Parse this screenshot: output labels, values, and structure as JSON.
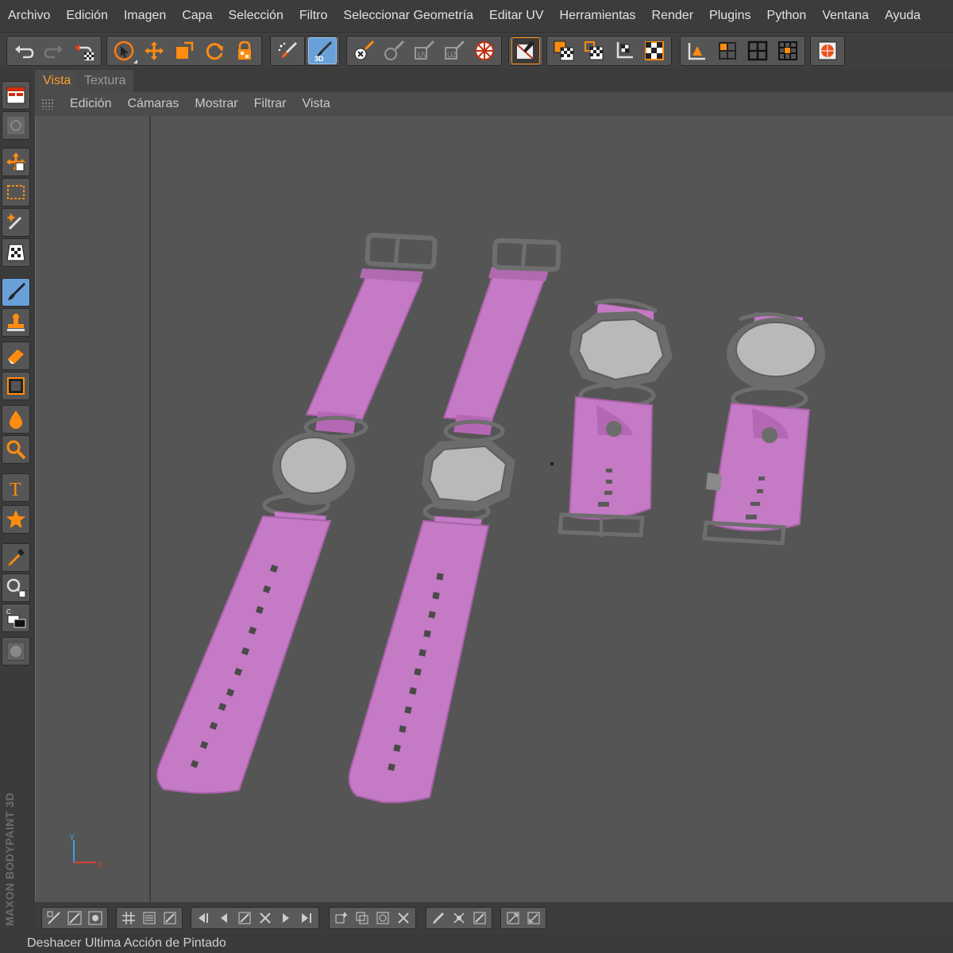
{
  "menubar": {
    "items": [
      "Archivo",
      "Edición",
      "Imagen",
      "Capa",
      "Selección",
      "Filtro",
      "Seleccionar Geometría",
      "Editar UV",
      "Herramientas",
      "Render",
      "Plugins",
      "Python",
      "Ventana",
      "Ayuda"
    ]
  },
  "toolbar": {
    "icons": [
      "undo-icon",
      "redo-icon",
      "undo-paint-icon",
      "live-selection-icon",
      "move-icon",
      "scale-icon",
      "rotate-icon",
      "lock-icon",
      "paint-3d-mode-icon",
      "brush-3d-icon",
      "uv-point-icon",
      "uv-edge-icon",
      "uv-polygon-icon",
      "texture-view-icon",
      "render-icon",
      "material-checker-icon",
      "texture-checker-icon",
      "projection-icon",
      "checker-icon",
      "axis-icon",
      "layout-single-icon",
      "layout-quad-icon",
      "layout-grid-icon",
      "render-sphere-icon"
    ],
    "mode_label": "3D"
  },
  "tabs": [
    {
      "label": "Vista",
      "active": true
    },
    {
      "label": "Textura",
      "active": false
    }
  ],
  "viewport_menu": {
    "items": [
      "Edición",
      "Cámaras",
      "Mostrar",
      "Filtrar",
      "Vista"
    ]
  },
  "viewport": {
    "axis": {
      "y_label": "Y",
      "x_label": "X"
    },
    "colors": {
      "background": "#555555",
      "strap": "#c47ac4",
      "strap_shade": "#a85ca8",
      "metal": "#6c6c6c",
      "face": "#b9b9b9"
    }
  },
  "leftbar": {
    "tools": [
      "layout-icon",
      "viewport-icon",
      "move-tool-icon",
      "rectangle-select-icon",
      "magic-wand-icon",
      "projection-paint-icon",
      "brush-icon",
      "clone-stamp-icon",
      "eraser-icon",
      "fill-icon",
      "smudge-icon",
      "magnify-icon",
      "text-tool-icon",
      "shape-star-icon",
      "eyedropper-icon",
      "zoom-select-icon",
      "color-swatch-icon",
      "sphere-preview-icon"
    ],
    "brand": "MAXON BODYPAINT 3D"
  },
  "status": {
    "text": "Deshacer Ultima Acción de Pintado"
  }
}
